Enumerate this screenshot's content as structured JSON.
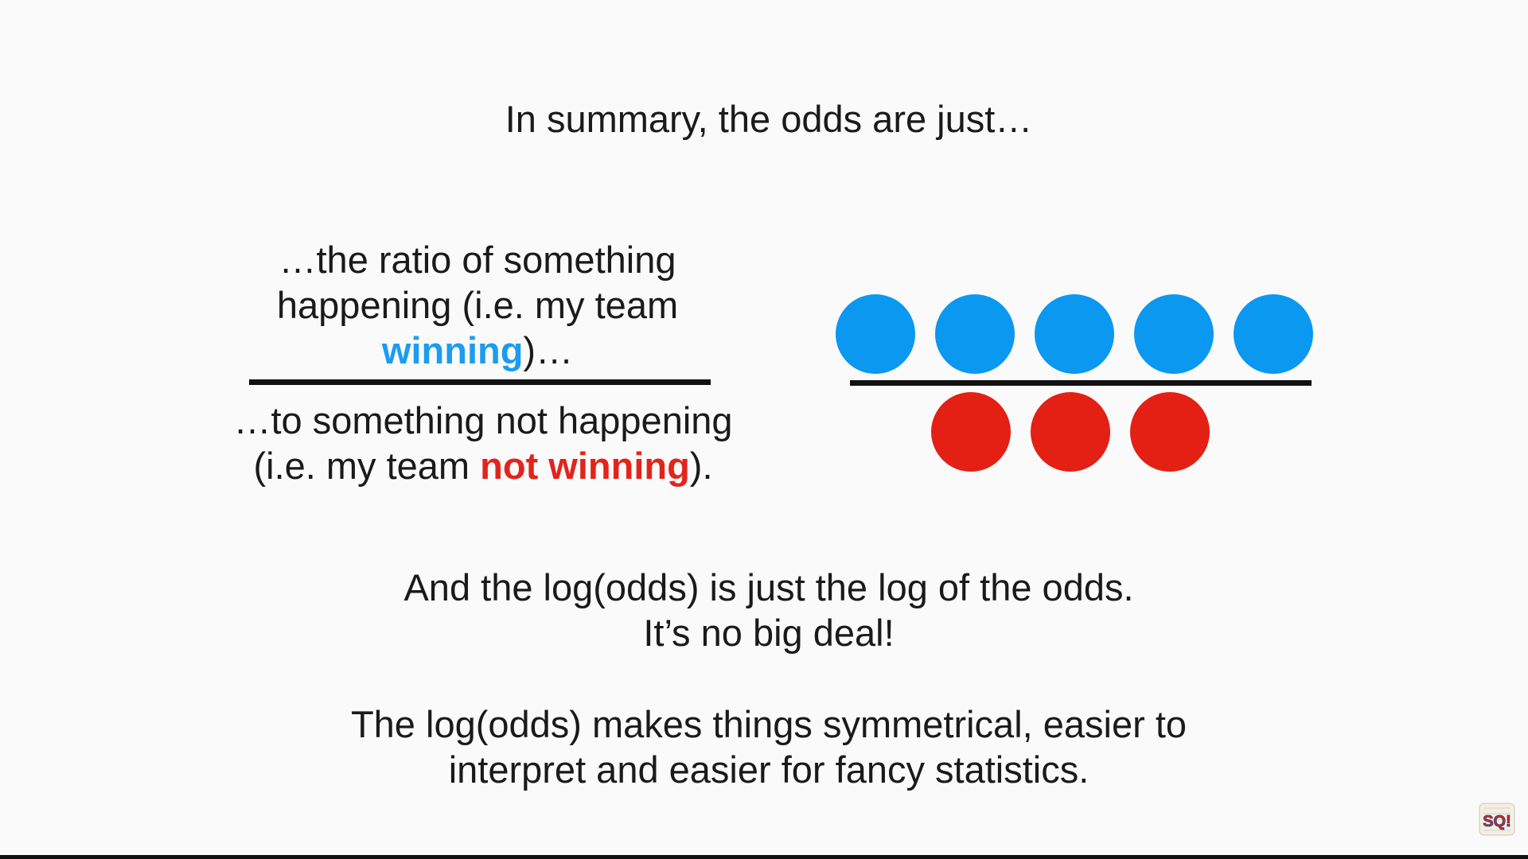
{
  "slide": {
    "title": "In summary, the odds are just…",
    "fraction": {
      "numerator_line1": "…the ratio of something",
      "numerator_line2": "happening (i.e. my team",
      "numerator_win_word": "winning",
      "numerator_tail": ")…",
      "denominator_line1": "…to something not happening",
      "denominator_lead": "(i.e. my team ",
      "denominator_lose_word": "not winning",
      "denominator_tail": ")."
    },
    "diagram": {
      "win_count": 5,
      "lose_count": 3,
      "win_color": "#0a98f0",
      "lose_color": "#e41f14"
    },
    "logodds_line1": "And the log(odds) is just the log of the odds.",
    "logodds_line2": "It’s no big deal!",
    "summary_line1": "The log(odds) makes things symmetrical, easier to",
    "summary_line2": "interpret and easier for fancy statistics.",
    "logo_text": "SQ!"
  }
}
